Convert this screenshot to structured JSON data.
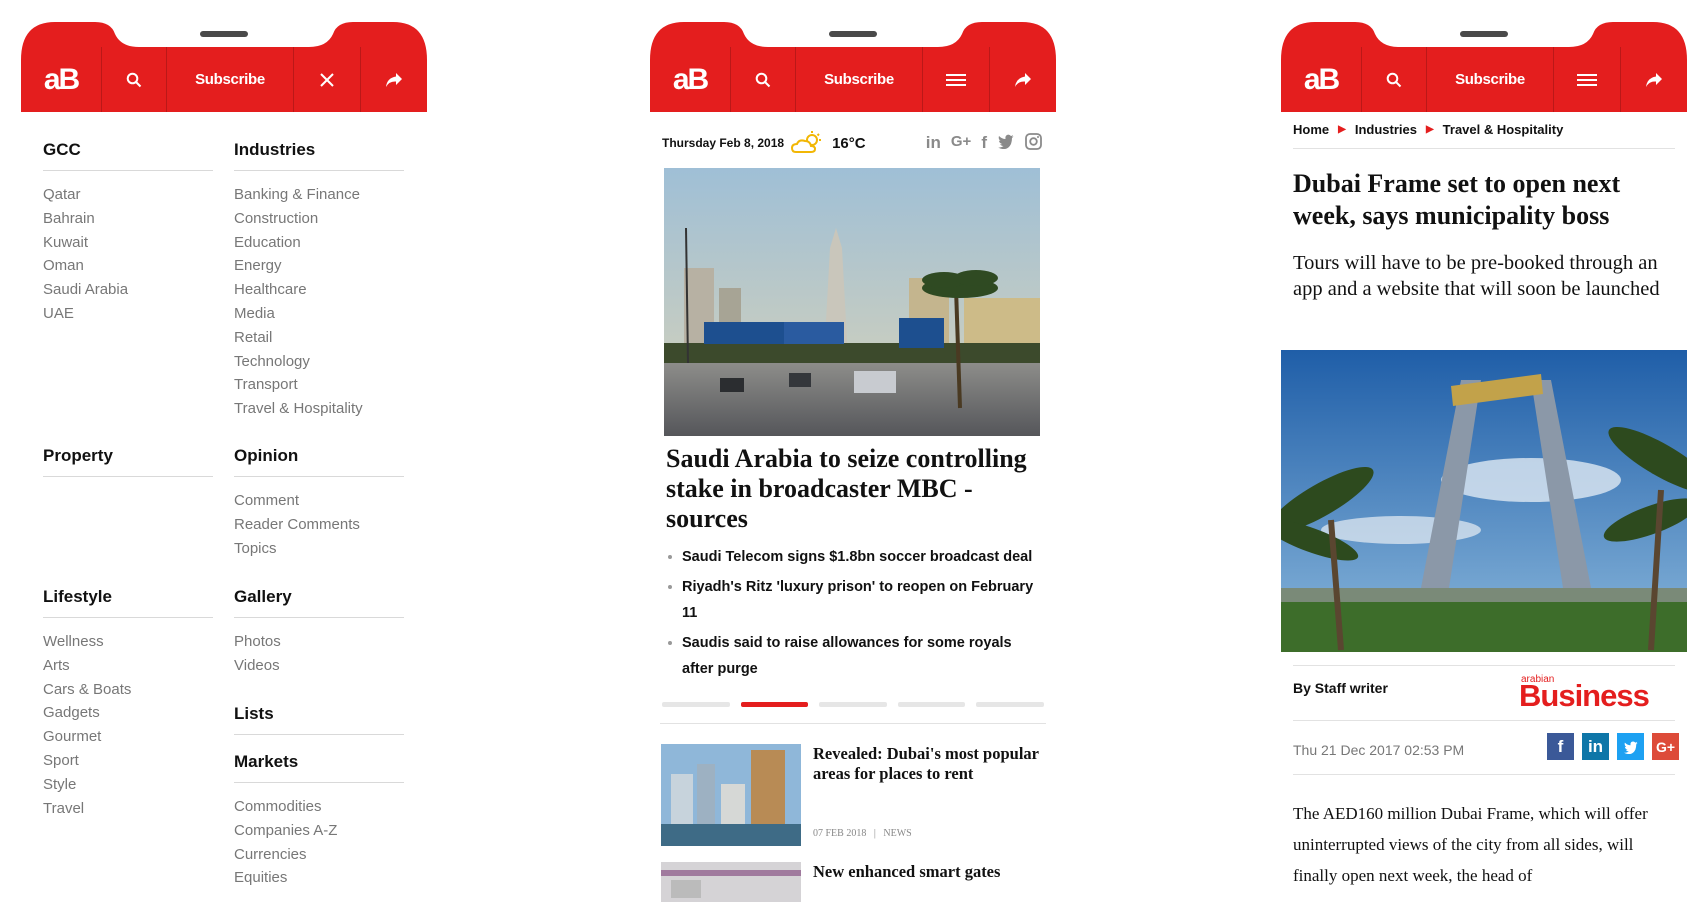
{
  "header": {
    "logo": "aB",
    "subscribe": "Subscribe"
  },
  "menu": {
    "left": [
      {
        "title": "GCC",
        "items": [
          "Qatar",
          "Bahrain",
          "Kuwait",
          "Oman",
          "Saudi Arabia",
          "UAE"
        ]
      },
      {
        "title": "Property",
        "items": []
      },
      {
        "title": "Lifestyle",
        "items": [
          "Wellness",
          "Arts",
          "Cars & Boats",
          "Gadgets",
          "Gourmet",
          "Sport",
          "Style",
          "Travel"
        ]
      }
    ],
    "right": [
      {
        "title": "Industries",
        "items": [
          "Banking & Finance",
          "Construction",
          "Education",
          "Energy",
          "Healthcare",
          "Media",
          "Retail",
          "Technology",
          "Transport",
          "Travel & Hospitality"
        ]
      },
      {
        "title": "Opinion",
        "items": [
          "Comment",
          "Reader Comments",
          "Topics"
        ]
      },
      {
        "title": "Gallery",
        "items": [
          "Photos",
          "Videos"
        ]
      },
      {
        "title": "Lists",
        "items": []
      },
      {
        "title": "Markets",
        "items": [
          "Commodities",
          "Companies A-Z",
          "Currencies",
          "Equities"
        ]
      }
    ]
  },
  "home": {
    "date": "Thursday Feb 8, 2018",
    "temperature": "16°C",
    "social": [
      "in",
      "G+",
      "f",
      "twitter",
      "instagram"
    ],
    "headline": "Saudi Arabia to seize controlling stake in broadcaster MBC - sources",
    "bullets": [
      "Saudi Telecom signs $1.8bn soccer broadcast deal",
      "Riyadh's Ritz 'luxury prison' to reopen on February 11",
      "Saudis said to raise allowances for some royals after purge"
    ],
    "carousel": {
      "count": 5,
      "active": 1
    },
    "cards": [
      {
        "title": "Revealed: Dubai's most popular areas for places to rent",
        "date": "07 FEB 2018",
        "category": "NEWS"
      },
      {
        "title": "New enhanced smart gates"
      }
    ]
  },
  "article": {
    "breadcrumb": [
      "Home",
      "Industries",
      "Travel & Hospitality"
    ],
    "title": "Dubai Frame set to open next week, says municipality boss",
    "subtitle": "Tours will have to be pre-booked through an app and a website that will soon be launched",
    "byline": "By Staff writer",
    "brand_small": "arabian",
    "brand_big": "Business",
    "date": "Thu 21 Dec 2017 02:53 PM",
    "share": [
      "f",
      "in",
      "t",
      "G+"
    ],
    "body": "The AED160 million Dubai Frame, which will offer uninterrupted views of the city from all sides, will finally open next week, the head of"
  },
  "colors": {
    "brand_red": "#e41e1e",
    "facebook": "#3b5998",
    "linkedin": "#0e76a8",
    "twitter": "#1da1f2",
    "googleplus": "#dd4b39"
  }
}
